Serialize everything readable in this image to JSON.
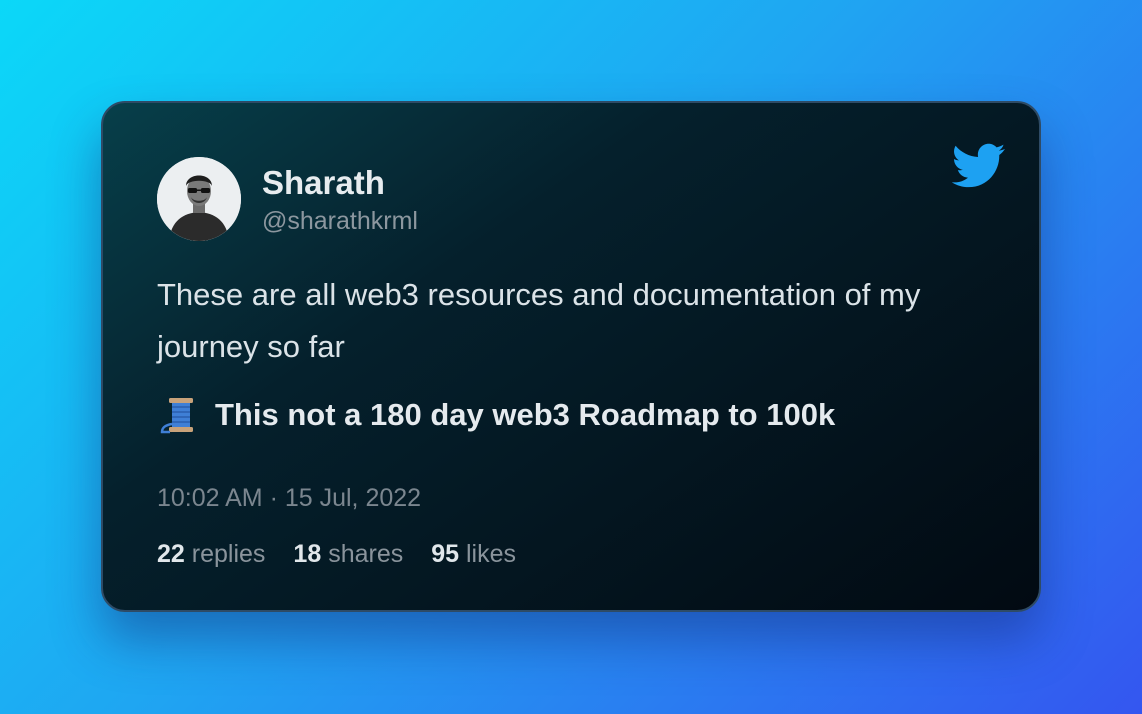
{
  "author": {
    "name": "Sharath",
    "handle": "@sharathkrml"
  },
  "tweet": {
    "text": "These are all web3 resources and documentation of my journey so far",
    "thread_title": "This not a 180 day web3 Roadmap to 100k",
    "thread_icon": "spool-of-thread-icon",
    "timestamp": "10:02 AM · 15 Jul, 2022"
  },
  "stats": {
    "replies_count": "22",
    "replies_label": "replies",
    "shares_count": "18",
    "shares_label": "shares",
    "likes_count": "95",
    "likes_label": "likes"
  },
  "colors": {
    "twitter_blue": "#1da1f2",
    "background_start": "#0bd8f8",
    "background_end": "#3456f0"
  },
  "icons": {
    "brand": "twitter-bird-icon",
    "avatar": "profile-photo"
  }
}
